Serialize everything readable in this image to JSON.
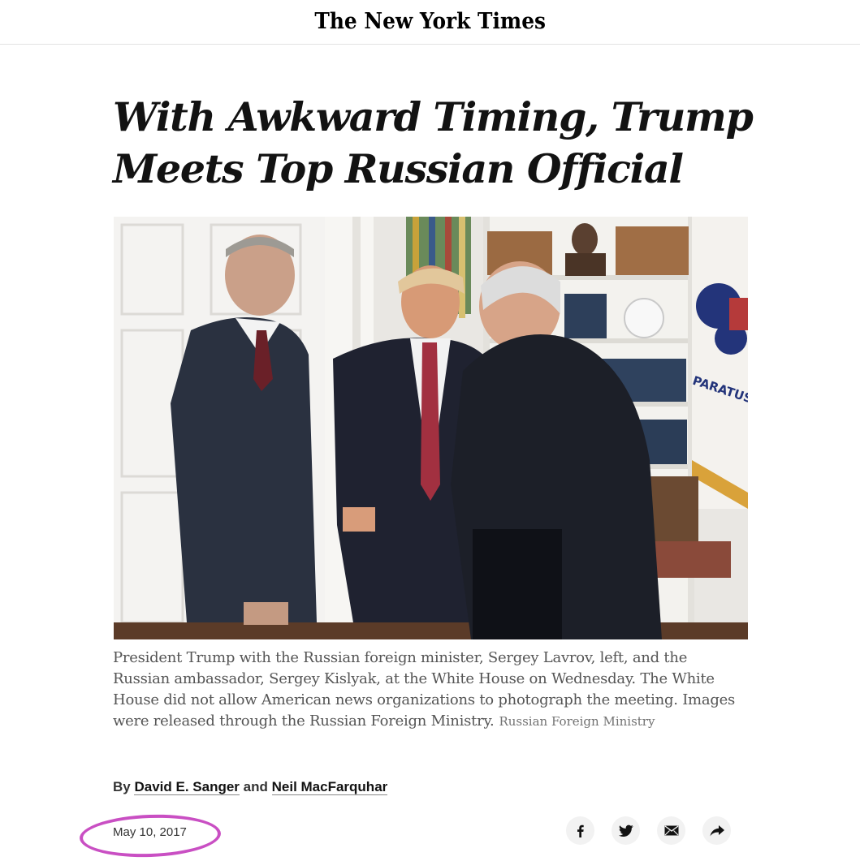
{
  "header": {
    "logo_text": "The New York Times"
  },
  "article": {
    "headline": "With Awkward Timing, Trump Meets Top Russian Official",
    "caption": "President Trump with the Russian foreign minister, Sergey Lavrov, left, and the Russian ambassador, Sergey Kislyak, at the White House on Wednesday. The White House did not allow American news organizations to photograph the meeting. Images were released through the Russian Foreign Ministry.",
    "photo_credit": "Russian Foreign Ministry",
    "byline": {
      "prefix": "By",
      "author1": "David E. Sanger",
      "conjunction": "and",
      "author2": "Neil MacFarquhar"
    },
    "date": "May 10, 2017"
  },
  "photo_scene": {
    "flag_text": "PARATUS"
  },
  "share": {
    "items": [
      "facebook-icon",
      "twitter-icon",
      "email-icon",
      "share-icon"
    ]
  },
  "colors": {
    "highlight": "#c94fc3",
    "caption": "#555555",
    "share_bg": "#f2f2f2"
  }
}
